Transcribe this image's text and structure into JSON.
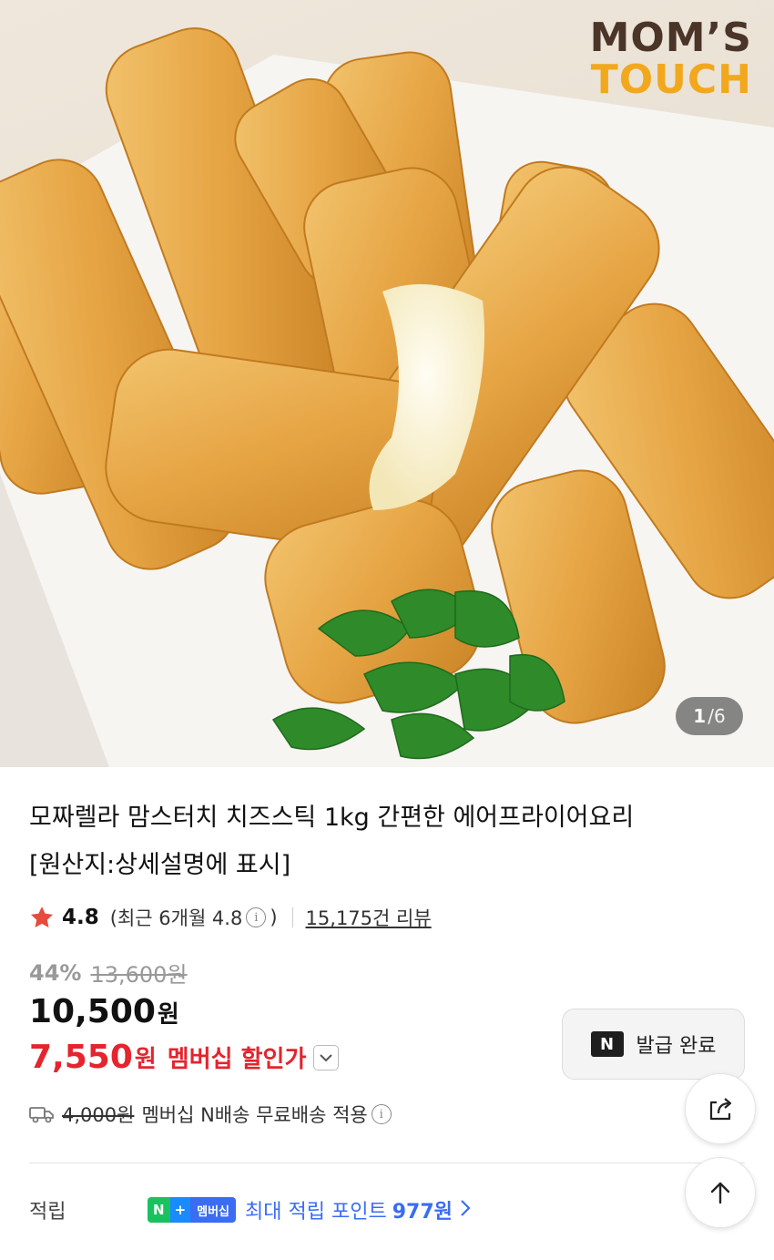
{
  "hero": {
    "brand_line1": "MOM’S",
    "brand_line2": "TOUCH",
    "counter_current": "1",
    "counter_total": "/6"
  },
  "product": {
    "title_line1": "모짜렐라 맘스터치 치즈스틱 1kg 간편한 에어프라이어요리",
    "title_line2": "[원산지:상세설명에 표시]"
  },
  "rating": {
    "score": "4.8",
    "recent_prefix": "(최근 6개월 4.8",
    "recent_suffix": ")",
    "reviews": "15,175건 리뷰"
  },
  "pricing": {
    "discount": "44%",
    "original": "13,600원",
    "price": "10,500",
    "price_unit": "원",
    "member_price": "7,550",
    "member_unit": "원",
    "member_label": "멤버십 할인가"
  },
  "shipping": {
    "original_fee": "4,000원",
    "text": "멤버십 N배송 무료배송 적용"
  },
  "points": {
    "label": "적립",
    "badge_n": "N",
    "badge_plus": "+",
    "badge_member": "멤버십",
    "text": "최대 적립 포인트",
    "value": "977원"
  },
  "coupon": {
    "logo": "N",
    "label": "발급 완료"
  },
  "colors": {
    "member_red": "#e4242e",
    "points_blue": "#3a6cf4",
    "naver_green": "#19c15f",
    "star": "#e84a3b"
  }
}
